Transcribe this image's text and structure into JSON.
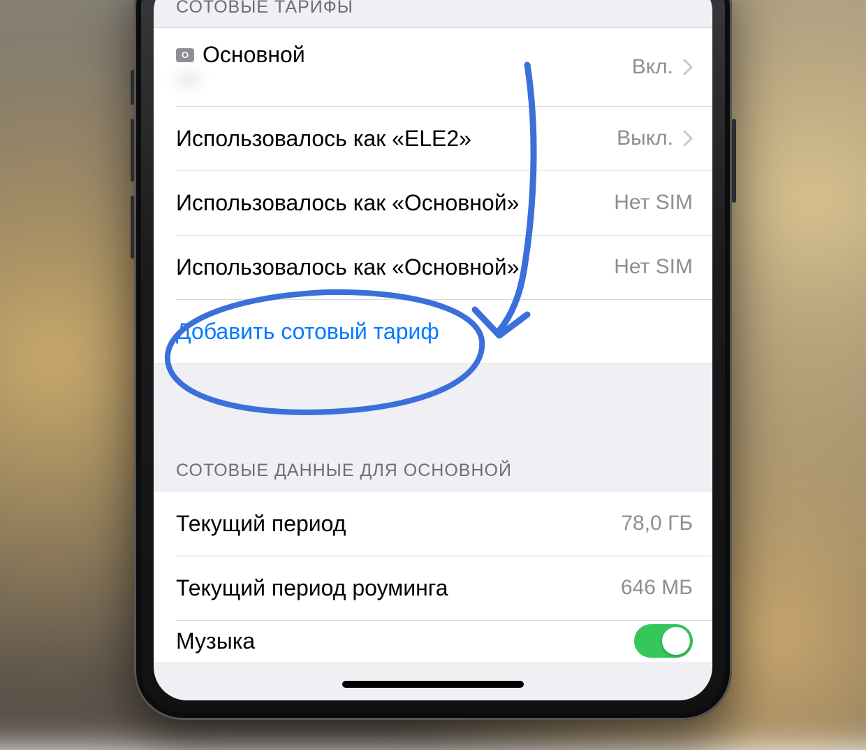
{
  "sections": {
    "plans": {
      "header": "СОТОВЫЕ ТАРИФЫ",
      "rows": [
        {
          "badge": "О",
          "title": "Основной",
          "sub": "+7",
          "value": "Вкл.",
          "chevron": true
        },
        {
          "title": "Использовалось как «ELE2»",
          "value": "Выкл.",
          "chevron": true
        },
        {
          "title": "Использовалось как «Основной»",
          "value": "Нет SIM",
          "chevron": false
        },
        {
          "title": "Использовалось как «Основной»",
          "value": "Нет SIM",
          "chevron": false
        }
      ],
      "add_label": "Добавить сотовый тариф"
    },
    "data": {
      "header": "СОТОВЫЕ ДАННЫЕ ДЛЯ ОСНОВНОЙ",
      "rows": [
        {
          "title": "Текущий период",
          "value": "78,0 ГБ"
        },
        {
          "title": "Текущий период роуминга",
          "value": "646 МБ"
        }
      ],
      "partial_title": "Музыка"
    }
  },
  "colors": {
    "link": "#0079ff",
    "annotation": "#3b6fd9"
  }
}
